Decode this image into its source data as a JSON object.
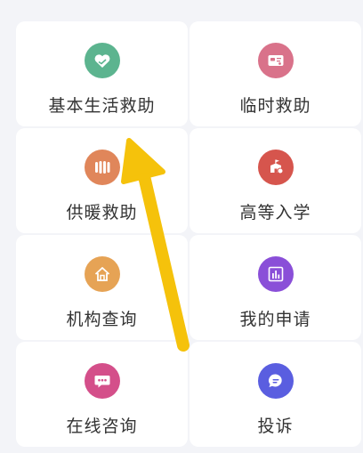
{
  "items": [
    {
      "label": "基本生活救助",
      "icon": "heart-card-icon",
      "color": "#5cb48f"
    },
    {
      "label": "临时救助",
      "icon": "id-card-icon",
      "color": "#d9728a"
    },
    {
      "label": "供暖救助",
      "icon": "radiator-icon",
      "color": "#e0865a"
    },
    {
      "label": "高等入学",
      "icon": "school-building-icon",
      "color": "#d6554d"
    },
    {
      "label": "机构查询",
      "icon": "home-icon",
      "color": "#e6a355"
    },
    {
      "label": "我的申请",
      "icon": "bar-chart-icon",
      "color": "#8a4fd8"
    },
    {
      "label": "在线咨询",
      "icon": "chat-bubble-dots-icon",
      "color": "#d44f8a"
    },
    {
      "label": "投诉",
      "icon": "message-lines-icon",
      "color": "#5a5ee0"
    }
  ],
  "overlay": {
    "arrow_color": "#f5c20b"
  }
}
